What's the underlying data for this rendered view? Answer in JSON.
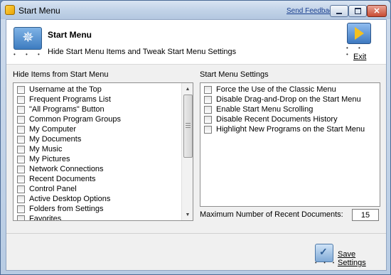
{
  "window": {
    "title": "Start Menu",
    "send_feedback": "Send Feedback",
    "close_glyph": "✕"
  },
  "header": {
    "title": "Start Menu",
    "subtitle": "Hide Start Menu Items and Tweak Start Menu Settings",
    "exit_label": "Exit",
    "icon_star": "✵",
    "dots": "• • •"
  },
  "hide_items": {
    "label": "Hide Items from Start Menu",
    "items": [
      {
        "label": "Username at the Top",
        "checked": false
      },
      {
        "label": "Frequent Programs List",
        "checked": false
      },
      {
        "label": "\"All Programs\" Button",
        "checked": false
      },
      {
        "label": "Common Program Groups",
        "checked": false
      },
      {
        "label": "My Computer",
        "checked": false
      },
      {
        "label": "My Documents",
        "checked": false
      },
      {
        "label": "My Music",
        "checked": false
      },
      {
        "label": "My Pictures",
        "checked": false
      },
      {
        "label": "Network Connections",
        "checked": false
      },
      {
        "label": "Recent Documents",
        "checked": false
      },
      {
        "label": "Control Panel",
        "checked": false
      },
      {
        "label": "Active Desktop Options",
        "checked": false
      },
      {
        "label": "Folders from Settings",
        "checked": false
      },
      {
        "label": "Favorites",
        "checked": false
      }
    ],
    "scroll_up": "▲",
    "scroll_down": "▼"
  },
  "settings": {
    "label": "Start Menu Settings",
    "items": [
      {
        "label": "Force the Use of the Classic Menu",
        "checked": false
      },
      {
        "label": "Disable Drag-and-Drop on the Start Menu",
        "checked": false
      },
      {
        "label": "Enable Start Menu Scrolling",
        "checked": false
      },
      {
        "label": "Disable Recent Documents History",
        "checked": false
      },
      {
        "label": "Highlight New Programs on the Start Menu",
        "checked": false
      }
    ],
    "max_recent_label": "Maximum Number of Recent Documents:",
    "max_recent_value": "15"
  },
  "footer": {
    "save_label": "Save Settings",
    "save_glyph": "✓",
    "dots": "• • •"
  },
  "colors": {
    "title_bar": "#c2d3e8",
    "client_bg": "#f0f0f0",
    "link": "#1a3f8f"
  }
}
